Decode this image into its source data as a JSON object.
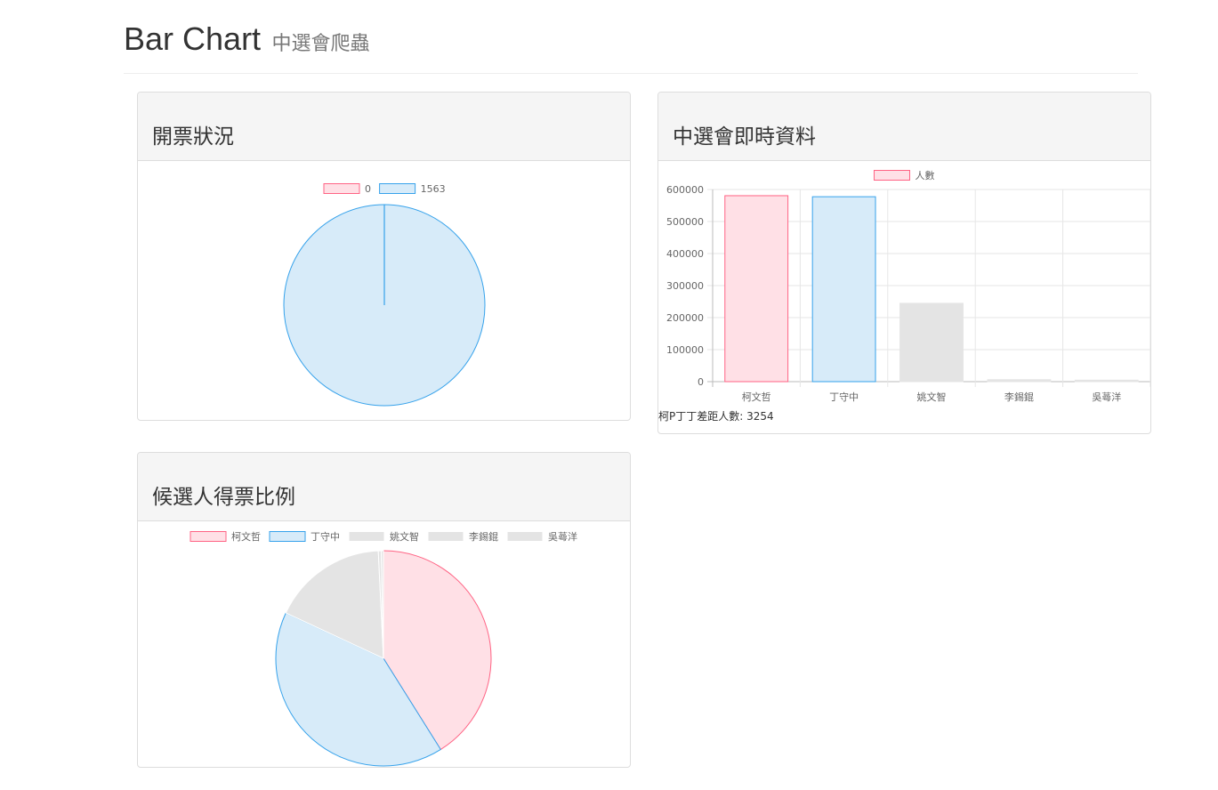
{
  "header": {
    "title": "Bar Chart",
    "subtitle": "中選會爬蟲"
  },
  "panels": {
    "status": {
      "title": "開票狀況"
    },
    "realtime": {
      "title": "中選會即時資料",
      "diff_text": "柯P丁丁差距人數: 3254"
    },
    "ratio": {
      "title": "候選人得票比例"
    }
  },
  "chart_data": [
    {
      "id": "status",
      "type": "pie",
      "labels": [
        "0",
        "1563"
      ],
      "values": [
        0,
        1563
      ],
      "colors": {
        "fill": [
          "#ffe0e6",
          "#d7ebf9"
        ],
        "stroke": [
          "#ff6384",
          "#36a2eb"
        ]
      }
    },
    {
      "id": "realtime",
      "type": "bar",
      "categories": [
        "柯文哲",
        "丁守中",
        "姚文智",
        "李錫錕",
        "吳蕚洋"
      ],
      "series": [
        {
          "name": "人數",
          "values": [
            580663,
            577409,
            244641,
            6147,
            4698
          ]
        }
      ],
      "ylim": [
        0,
        600000
      ],
      "yticks": [
        0,
        100000,
        200000,
        300000,
        400000,
        500000,
        600000
      ],
      "grid": true,
      "legend": "top",
      "colors": {
        "fill": [
          "#ffe0e6",
          "#d7ebf9",
          "#e4e4e4",
          "#e4e4e4",
          "#e4e4e4"
        ],
        "stroke": [
          "#ff6384",
          "#36a2eb",
          "#e4e4e4",
          "#e4e4e4",
          "#e4e4e4"
        ]
      }
    },
    {
      "id": "ratio",
      "type": "pie",
      "labels": [
        "柯文哲",
        "丁守中",
        "姚文智",
        "李錫錕",
        "吳蕚洋"
      ],
      "values": [
        580663,
        577409,
        244641,
        6147,
        4698
      ],
      "legend": "top",
      "colors": {
        "fill": [
          "#ffe0e6",
          "#d7ebf9",
          "#e4e4e4",
          "#e4e4e4",
          "#e4e4e4"
        ],
        "stroke": [
          "#ff6384",
          "#36a2eb",
          "#ffffff",
          "#ffffff",
          "#ffffff"
        ]
      }
    }
  ]
}
